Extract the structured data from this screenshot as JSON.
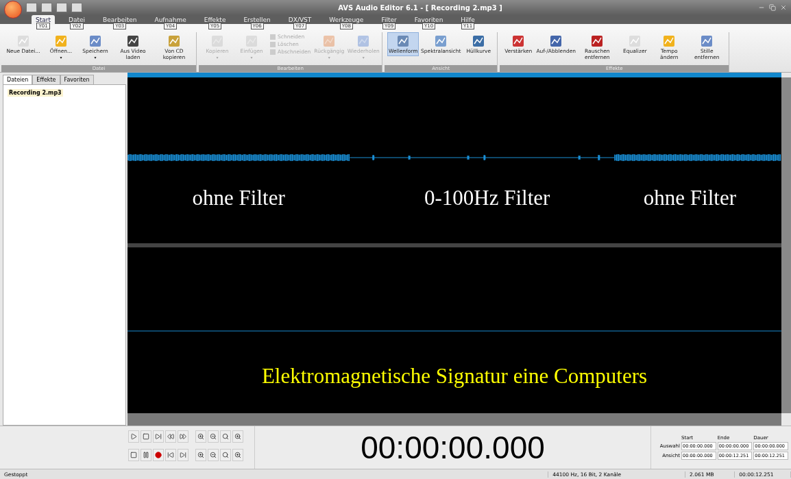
{
  "window": {
    "title": "AVS Audio Editor 6.1 - [ Recording 2.mp3 ]"
  },
  "menu_tabs": [
    {
      "label": "Start",
      "keytip": "Y01",
      "selected": true
    },
    {
      "label": "Datei",
      "keytip": "Y02",
      "selected": false
    },
    {
      "label": "Bearbeiten",
      "keytip": "Y03",
      "selected": false
    },
    {
      "label": "Aufnahme",
      "keytip": "Y04",
      "selected": false
    },
    {
      "label": "Effekte",
      "keytip": "Y05",
      "selected": false
    },
    {
      "label": "Erstellen",
      "keytip": "Y06",
      "selected": false
    },
    {
      "label": "DX/VST",
      "keytip": "Y07",
      "selected": false
    },
    {
      "label": "Werkzeuge",
      "keytip": "Y08",
      "selected": false
    },
    {
      "label": "Filter",
      "keytip": "Y09",
      "selected": false
    },
    {
      "label": "Favoriten",
      "keytip": "Y10",
      "selected": false
    },
    {
      "label": "Hilfe",
      "keytip": "Y11",
      "selected": false
    }
  ],
  "ribbon_groups": [
    {
      "title": "Datei",
      "items": [
        {
          "kind": "large",
          "label": "Neue Datei...",
          "disabled": false,
          "selected": false
        },
        {
          "kind": "large",
          "label": "Öffnen...",
          "disabled": false,
          "selected": false,
          "caret": "▾"
        },
        {
          "kind": "large",
          "label": "Speichern",
          "disabled": false,
          "selected": false,
          "caret": "▾"
        },
        {
          "kind": "large",
          "label": "Aus Video laden",
          "disabled": false,
          "selected": false
        },
        {
          "kind": "large",
          "label": "Von CD kopieren",
          "disabled": false,
          "selected": false
        }
      ]
    },
    {
      "title": "Bearbeiten",
      "items": [
        {
          "kind": "large",
          "label": "Kopieren",
          "disabled": true,
          "selected": false,
          "caret": "▾"
        },
        {
          "kind": "large",
          "label": "Einfügen",
          "disabled": true,
          "selected": false,
          "caret": "▾"
        },
        {
          "kind": "small",
          "label": "Schneiden",
          "disabled": true
        },
        {
          "kind": "small",
          "label": "Löschen",
          "disabled": true
        },
        {
          "kind": "small",
          "label": "Abschneiden",
          "disabled": true
        },
        {
          "kind": "large",
          "label": "Rückgängig",
          "disabled": true,
          "selected": false,
          "caret": "▾"
        },
        {
          "kind": "large",
          "label": "Wiederholen",
          "disabled": true,
          "selected": false,
          "caret": "▾"
        }
      ]
    },
    {
      "title": "Ansicht",
      "items": [
        {
          "kind": "large",
          "label": "Wellenform",
          "disabled": false,
          "selected": true
        },
        {
          "kind": "large",
          "label": "Spektralansicht",
          "disabled": false,
          "selected": false
        },
        {
          "kind": "large",
          "label": "Hüllkurve",
          "disabled": false,
          "selected": false
        }
      ]
    },
    {
      "title": "Effekte",
      "items": [
        {
          "kind": "large",
          "label": "Verstärken",
          "disabled": false,
          "selected": false
        },
        {
          "kind": "large",
          "label": "Auf-/Abblenden",
          "disabled": false,
          "selected": false
        },
        {
          "kind": "large",
          "label": "Rauschen entfernen",
          "disabled": false,
          "selected": false
        },
        {
          "kind": "large",
          "label": "Equalizer",
          "disabled": false,
          "selected": false
        },
        {
          "kind": "large",
          "label": "Tempo ändern",
          "disabled": false,
          "selected": false
        },
        {
          "kind": "large",
          "label": "Stille entfernen",
          "disabled": false,
          "selected": false
        }
      ]
    }
  ],
  "side_tabs": [
    {
      "label": "Dateien",
      "selected": true
    },
    {
      "label": "Effekte",
      "selected": false
    },
    {
      "label": "Favoriten",
      "selected": false
    }
  ],
  "files": [
    {
      "name": "Recording 2.mp3",
      "selected": true
    }
  ],
  "waveform": {
    "captions": [
      "ohne Filter",
      "0-100Hz Filter",
      "ohne Filter"
    ],
    "bottom_caption": "Elektromagnetische Signatur eine Computers"
  },
  "time_display": "00:00:00.000",
  "selection": {
    "columns": [
      "Start",
      "Ende",
      "Dauer"
    ],
    "rows": [
      {
        "label": "Auswahl",
        "values": [
          "00:00:00.000",
          "00:00:00.000",
          "00:00:00.000"
        ]
      },
      {
        "label": "Ansicht",
        "values": [
          "00:00:00.000",
          "00:00:12.251",
          "00:00:12.251"
        ]
      }
    ]
  },
  "status_bar": {
    "state": "Gestoppt",
    "format": "44100 Hz, 16 Bit, 2 Kanäle",
    "size": "2.061 MB",
    "length": "00:00:12.251"
  }
}
